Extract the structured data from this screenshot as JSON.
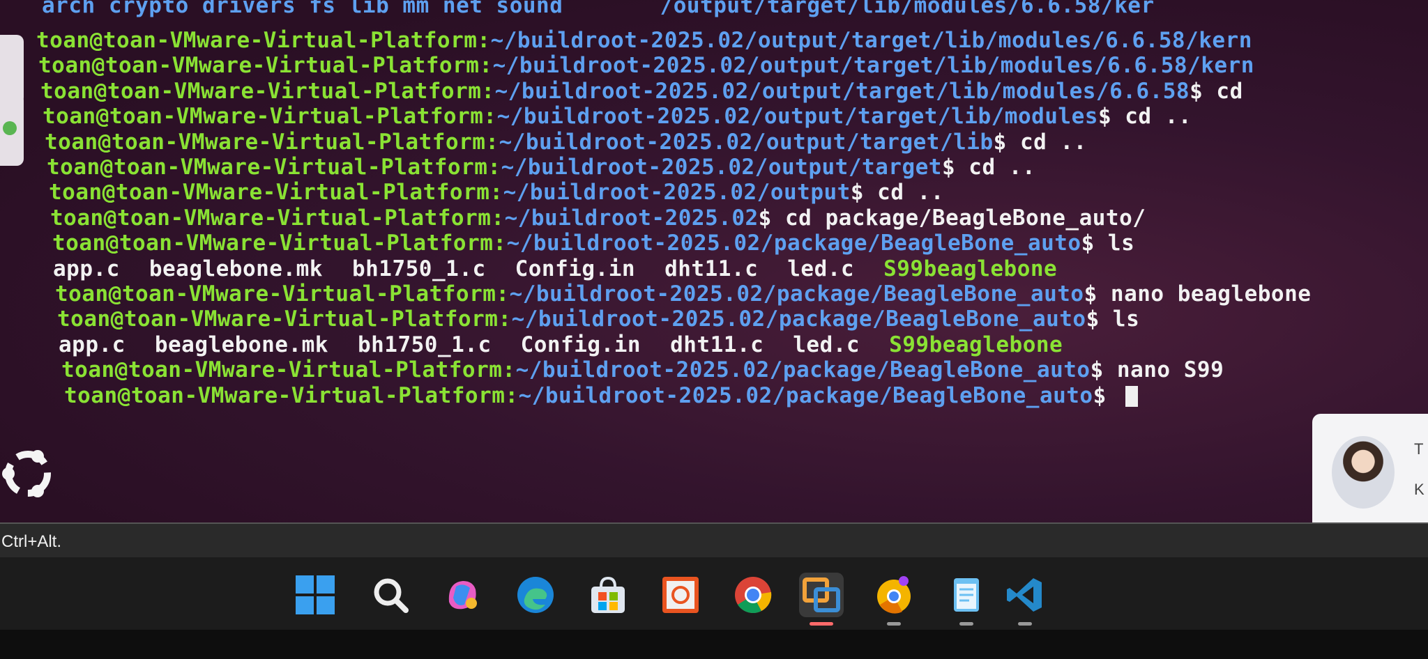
{
  "terminal": {
    "top_partial": "arch  crypto  drivers  fs  lib  mm  net  sound",
    "top_partial_path_tail": "/output/target/lib/modules/6.6.58/ker",
    "lines": [
      {
        "user": "toan@toan-VMware-Virtual-Platform:",
        "path": "~/buildroot-2025.02/output/target/lib/modules/6.6.58/kern",
        "cmd": ""
      },
      {
        "user": "toan@toan-VMware-Virtual-Platform:",
        "path": "~/buildroot-2025.02/output/target/lib/modules/6.6.58/kern",
        "cmd": ""
      },
      {
        "user": "toan@toan-VMware-Virtual-Platform:",
        "path": "~/buildroot-2025.02/output/target/lib/modules/6.6.58",
        "cmd": "$ cd"
      },
      {
        "user": "toan@toan-VMware-Virtual-Platform:",
        "path": "~/buildroot-2025.02/output/target/lib/modules",
        "cmd": "$ cd .."
      },
      {
        "user": "toan@toan-VMware-Virtual-Platform:",
        "path": "~/buildroot-2025.02/output/target/lib",
        "cmd": "$ cd .."
      },
      {
        "user": "toan@toan-VMware-Virtual-Platform:",
        "path": "~/buildroot-2025.02/output/target",
        "cmd": "$ cd .."
      },
      {
        "user": "toan@toan-VMware-Virtual-Platform:",
        "path": "~/buildroot-2025.02/output",
        "cmd": "$ cd .."
      },
      {
        "user": "toan@toan-VMware-Virtual-Platform:",
        "path": "~/buildroot-2025.02",
        "cmd": "$ cd package/BeagleBone_auto/"
      },
      {
        "user": "toan@toan-VMware-Virtual-Platform:",
        "path": "~/buildroot-2025.02/package/BeagleBone_auto",
        "cmd": "$ ls"
      }
    ],
    "ls_output_1": {
      "files": [
        "app.c",
        "beaglebone.mk",
        "bh1750_1.c",
        "Config.in",
        "dht11.c",
        "led.c"
      ],
      "exec": "S99beaglebone"
    },
    "lines2": [
      {
        "user": "toan@toan-VMware-Virtual-Platform:",
        "path": "~/buildroot-2025.02/package/BeagleBone_auto",
        "cmd": "$ nano beaglebone"
      },
      {
        "user": "toan@toan-VMware-Virtual-Platform:",
        "path": "~/buildroot-2025.02/package/BeagleBone_auto",
        "cmd": "$ ls"
      }
    ],
    "ls_output_2": {
      "files": [
        "app.c",
        "beaglebone.mk",
        "bh1750_1.c",
        "Config.in",
        "dht11.c",
        "led.c"
      ],
      "exec": "S99beaglebone"
    },
    "lines3": [
      {
        "user": "toan@toan-VMware-Virtual-Platform:",
        "path": "~/buildroot-2025.02/package/BeagleBone_auto",
        "cmd": "$ nano S99"
      },
      {
        "user": "toan@toan-VMware-Virtual-Platform:",
        "path": "~/buildroot-2025.02/package/BeagleBone_auto",
        "cmd": "$ "
      }
    ],
    "colors": {
      "user": "#8ae234",
      "path": "#5ea0f0",
      "text": "#f2f2f2"
    }
  },
  "statusbar": {
    "hint": "Ctrl+Alt."
  },
  "notification": {
    "char1": "T",
    "char2": "K"
  },
  "taskbar": {
    "icons": [
      "windows-start-icon",
      "search-icon",
      "copilot-icon",
      "edge-icon",
      "store-icon",
      "ubuntu-app-icon",
      "chrome-icon",
      "vmware-icon",
      "chrome-canary-icon",
      "notepad-icon",
      "vscode-icon"
    ],
    "active": "vmware-icon"
  }
}
